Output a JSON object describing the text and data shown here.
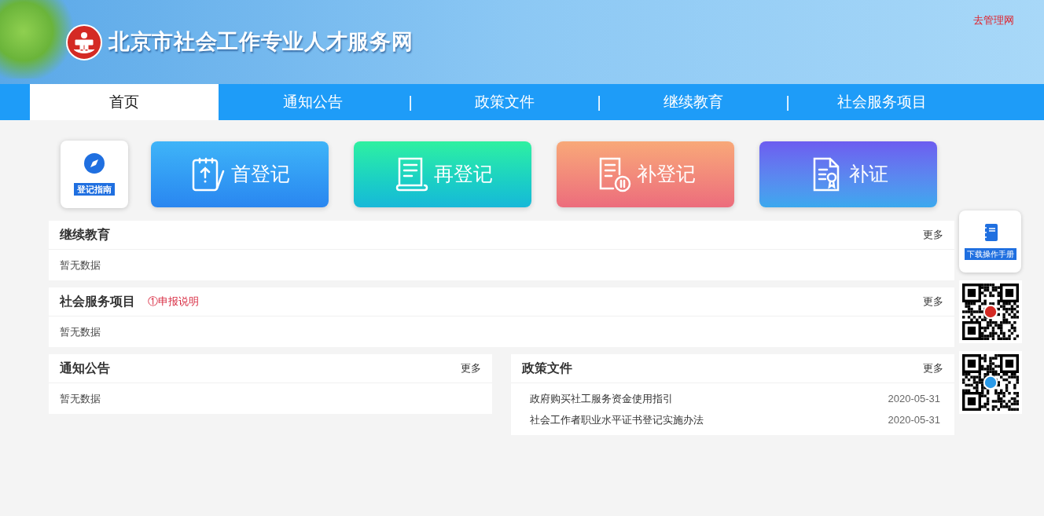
{
  "header": {
    "site_title": "北京市社会工作专业人才服务网",
    "admin_link": "去管理网"
  },
  "nav": [
    {
      "label": "首页",
      "selected": true
    },
    {
      "label": "通知公告",
      "selected": false
    },
    {
      "label": "政策文件",
      "selected": false,
      "separator": "|"
    },
    {
      "label": "继续教育",
      "selected": false,
      "separator": "|"
    },
    {
      "label": "社会服务项目",
      "selected": false,
      "separator": "|"
    }
  ],
  "guide": {
    "label": "登记指南"
  },
  "actions": [
    {
      "label": "首登记",
      "kind": "first"
    },
    {
      "label": "再登记",
      "kind": "again"
    },
    {
      "label": "补登记",
      "kind": "supplement"
    },
    {
      "label": "补证",
      "kind": "certificate"
    }
  ],
  "panels": [
    {
      "title": "继续教育",
      "more": "更多",
      "empty": "暂无数据"
    },
    {
      "title": "社会服务项目",
      "note": "①申报说明",
      "more": "更多",
      "empty": "暂无数据"
    }
  ],
  "bottom_panels": [
    {
      "title": "通知公告",
      "more": "更多",
      "empty": "暂无数据"
    },
    {
      "title": "政策文件",
      "more": "更多",
      "items": [
        {
          "title": "政府购买社工服务资金使用指引",
          "date": "2020-05-31"
        },
        {
          "title": "社会工作者职业水平证书登记实施办法",
          "date": "2020-05-31"
        }
      ]
    }
  ],
  "side": {
    "manual": "下载操作手册"
  }
}
